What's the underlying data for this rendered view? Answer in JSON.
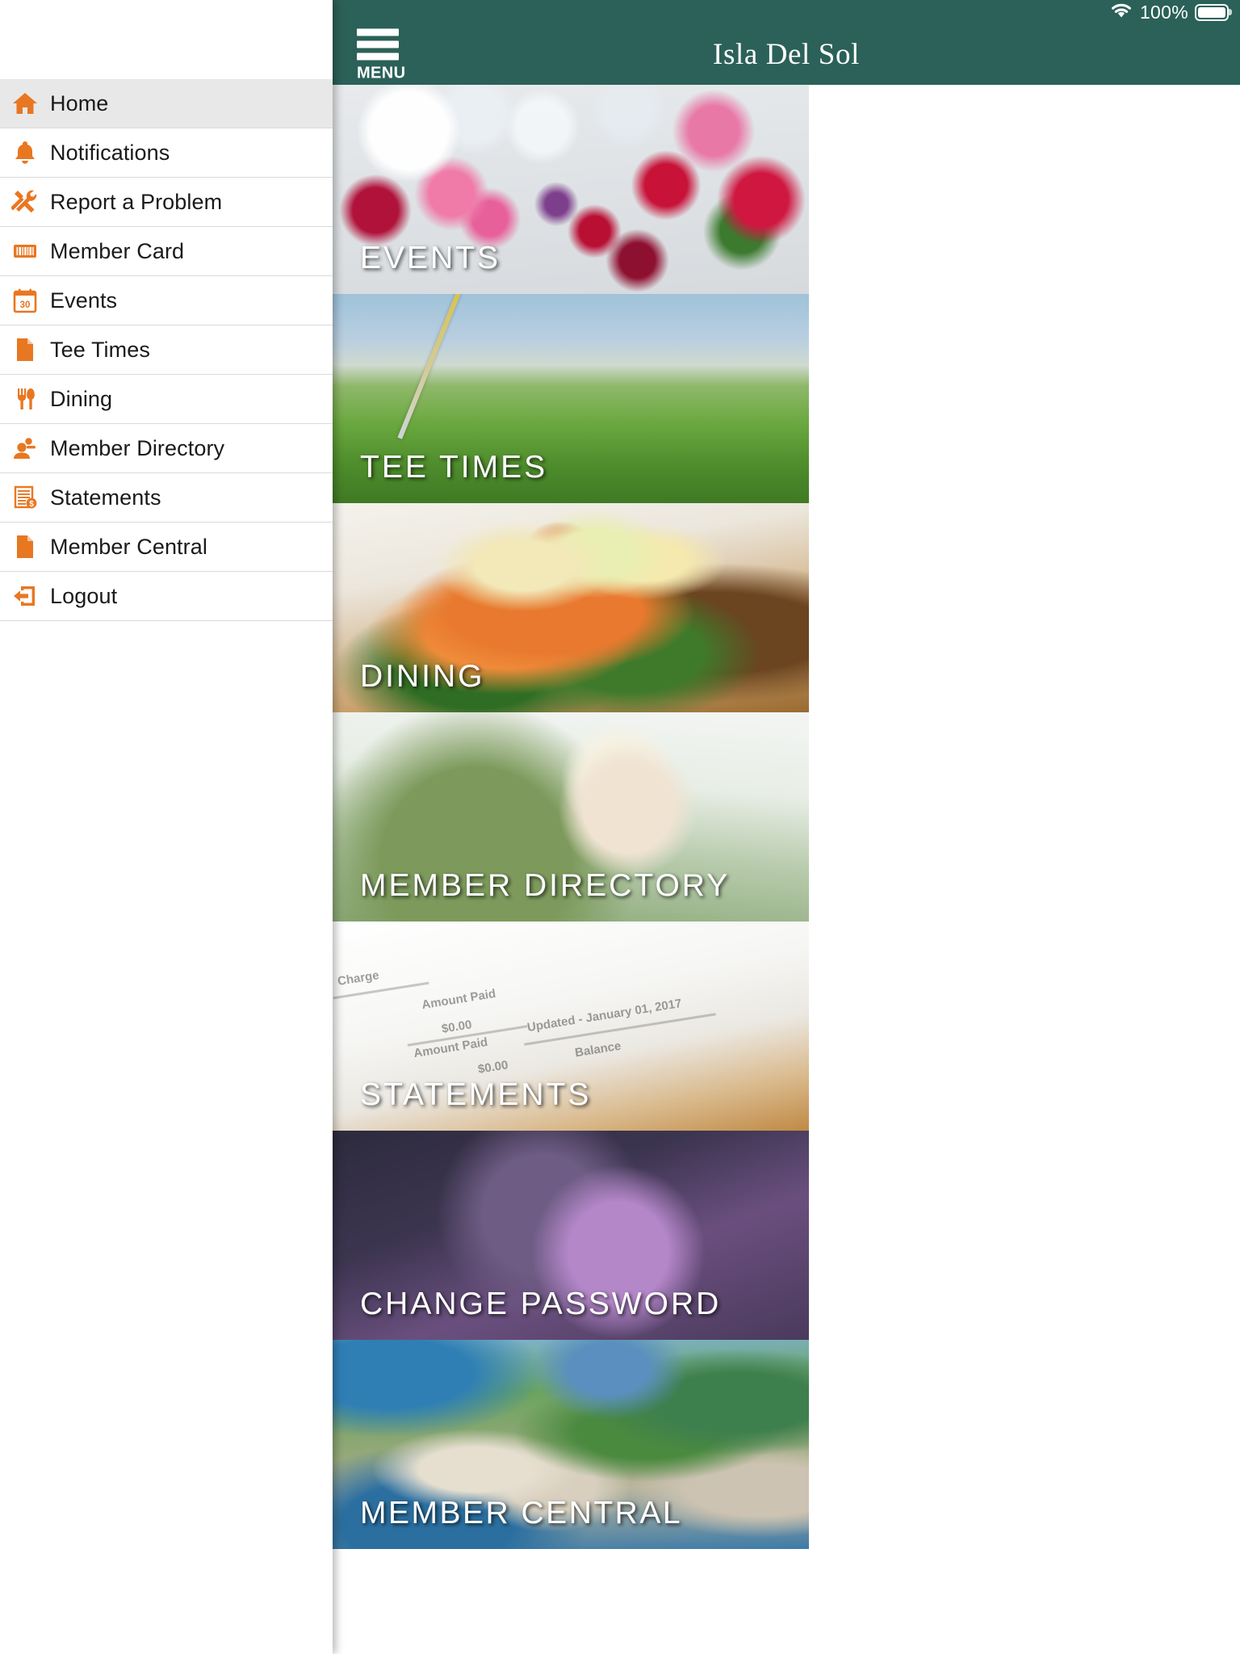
{
  "statusbar": {
    "wifi_icon": "wifi-icon",
    "battery_percent": "100%",
    "battery_icon": "battery-full-icon"
  },
  "navbar": {
    "menu_icon": "hamburger-menu-icon",
    "menu_label": "MENU",
    "title": "Isla Del Sol",
    "background_color": "#2b6158"
  },
  "drawer": {
    "items": [
      {
        "label": "Home",
        "icon": "home-icon",
        "active": true
      },
      {
        "label": "Notifications",
        "icon": "bell-icon",
        "active": false
      },
      {
        "label": "Report a Problem",
        "icon": "hammer-wrench-icon",
        "active": false
      },
      {
        "label": "Member Card",
        "icon": "barcode-card-icon",
        "active": false
      },
      {
        "label": "Events",
        "icon": "calendar-30-icon",
        "active": false
      },
      {
        "label": "Tee Times",
        "icon": "document-icon",
        "active": false
      },
      {
        "label": "Dining",
        "icon": "fork-knife-icon",
        "active": false
      },
      {
        "label": "Member Directory",
        "icon": "person-directory-icon",
        "active": false
      },
      {
        "label": "Statements",
        "icon": "statement-dollar-icon",
        "active": false
      },
      {
        "label": "Member Central",
        "icon": "document-icon",
        "active": false
      },
      {
        "label": "Logout",
        "icon": "logout-arrow-icon",
        "active": false
      }
    ],
    "accent_color": "#e87722",
    "active_background": "#e8e8e8"
  },
  "tiles": [
    {
      "label": "EVENTS",
      "photo": "ph-events",
      "name": "tile-events"
    },
    {
      "label": "TEE TIMES",
      "photo": "ph-tee",
      "name": "tile-tee-times"
    },
    {
      "label": "DINING",
      "photo": "ph-dining",
      "name": "tile-dining"
    },
    {
      "label": "MEMBER DIRECTORY",
      "photo": "ph-member",
      "name": "tile-member-directory"
    },
    {
      "label": "STATEMENTS",
      "photo": "ph-statements",
      "name": "tile-statements"
    },
    {
      "label": "CHANGE PASSWORD",
      "photo": "ph-change",
      "name": "tile-change-password"
    },
    {
      "label": "MEMBER CENTRAL",
      "photo": "ph-central",
      "name": "tile-member-central"
    }
  ],
  "statement_photo_text": {
    "words": [
      "Charge",
      "Amount Paid",
      "$0.00",
      "Amount Paid",
      "Updated - January 01, 2017",
      "Balance",
      "$0.00"
    ]
  }
}
